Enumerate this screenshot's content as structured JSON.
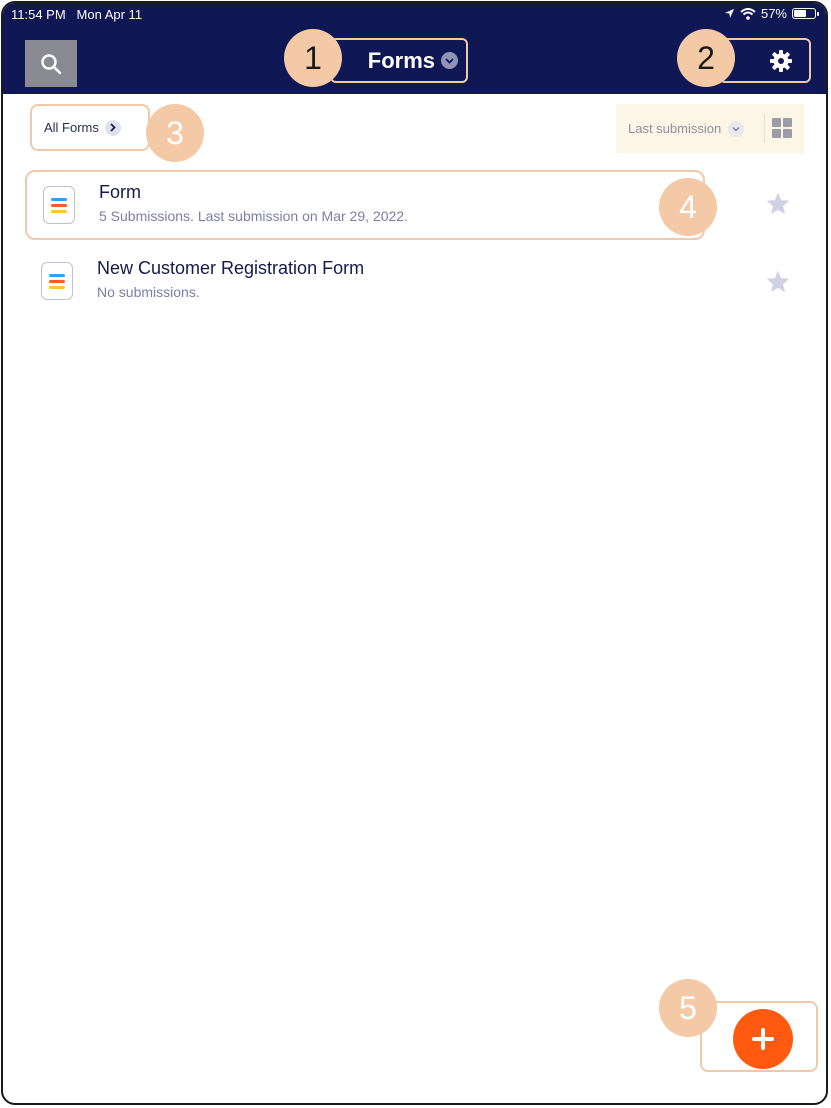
{
  "status_bar": {
    "time": "11:54 PM",
    "date": "Mon Apr 11",
    "battery": "57%"
  },
  "header": {
    "title": "Forms",
    "search_icon": "search-icon",
    "settings_icon": "gear-icon"
  },
  "callouts": [
    "1",
    "2",
    "3",
    "4",
    "5"
  ],
  "toolbar": {
    "all_forms_label": "All Forms",
    "sort_label": "Last submission",
    "view_icon": "grid-view-icon"
  },
  "forms": [
    {
      "title": "Form",
      "subtitle": "5 Submissions. Last submission on Mar 29, 2022."
    },
    {
      "title": "New Customer Registration Form",
      "subtitle": "No submissions."
    }
  ],
  "fab": {
    "icon": "plus-icon"
  },
  "colors": {
    "header_bg": "#0f1754",
    "accent": "#ff5a0f",
    "callout": "#f4c9a6"
  }
}
